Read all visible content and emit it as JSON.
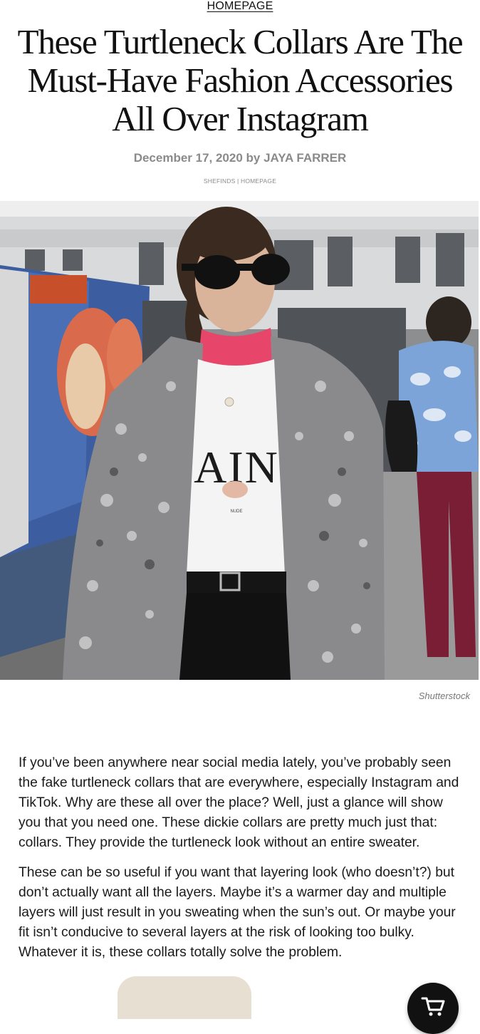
{
  "article": {
    "category": "HOMEPAGE",
    "title": "These Turtleneck Collars Are The Must-Have Fashion Accessories All Over Instagram",
    "byline": "December 17, 2020 by JAYA FARRER",
    "tags": "SHEFINDS | HOMEPAGE",
    "image_credit": "Shutterstock",
    "paragraphs": [
      "If you’ve been anywhere near social media lately, you’ve probably seen the fake turtleneck collars that are everywhere, especially Instagram and TikTok. Why are these all over the place? Well, just a glance will show you that you need one. These dickie collars are pretty much just that: collars. They provide the turtleneck look without an entire sweater.",
      "These can be so useful if you want that layering look (who doesn’t?) but don’t actually want all the layers. Maybe it’s a warmer day and multiple layers will just result in you sweating when the sun’s out. Or maybe your fit isn’t conducive to several layers at the risk of looking too bulky. Whatever it is, these collars totally solve the problem."
    ]
  },
  "hero_image": {
    "shirt_print": "AIN",
    "shirt_small_print": "NUDE"
  },
  "icons": {
    "cart": "shopping-cart-icon"
  },
  "colors": {
    "byline_gray": "#8a8a8a",
    "collar_pink": "#e8456b",
    "cart_button": "#111111"
  }
}
